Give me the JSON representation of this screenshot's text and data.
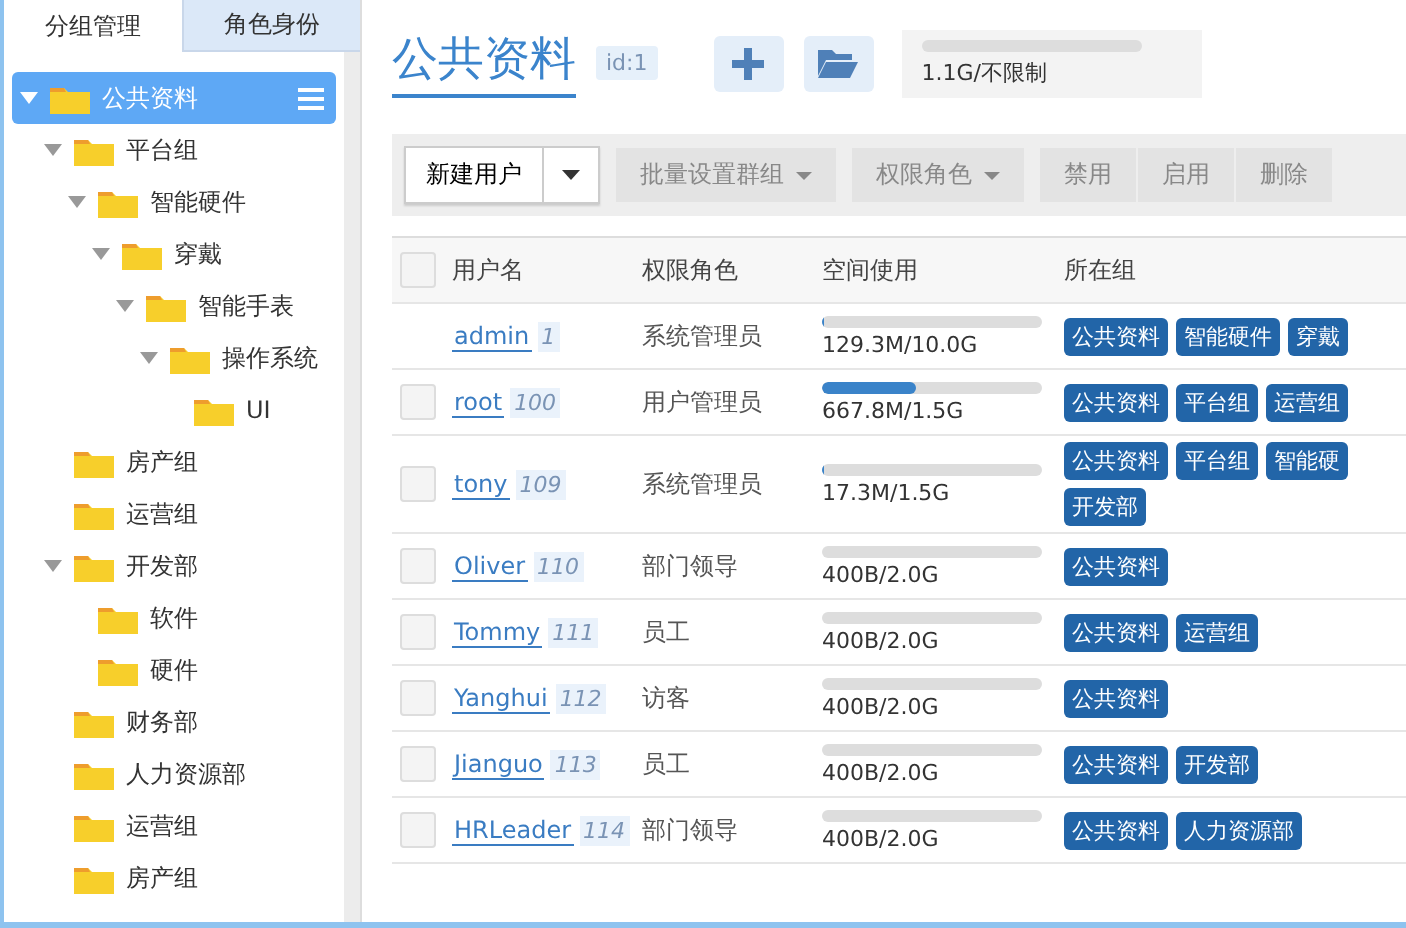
{
  "sidebar": {
    "tabs": [
      {
        "label": "分组管理",
        "selected": true
      },
      {
        "label": "角色身份",
        "selected": false
      }
    ],
    "tree": [
      {
        "label": "公共资料",
        "selected": true,
        "expanded": true,
        "children": [
          {
            "label": "平台组",
            "selected": false,
            "expanded": true,
            "children": [
              {
                "label": "智能硬件",
                "selected": false,
                "expanded": true,
                "children": [
                  {
                    "label": "穿戴",
                    "selected": false,
                    "expanded": true,
                    "children": [
                      {
                        "label": "智能手表",
                        "selected": false,
                        "expanded": true,
                        "children": [
                          {
                            "label": "操作系统",
                            "selected": false,
                            "expanded": true,
                            "children": [
                              {
                                "label": "UI",
                                "selected": false,
                                "expanded": false
                              }
                            ]
                          }
                        ]
                      }
                    ]
                  }
                ]
              }
            ]
          },
          {
            "label": "房产组",
            "selected": false,
            "expanded": false
          },
          {
            "label": "运营组",
            "selected": false,
            "expanded": false
          },
          {
            "label": "开发部",
            "selected": false,
            "expanded": true,
            "children": [
              {
                "label": "软件",
                "selected": false,
                "expanded": false
              },
              {
                "label": "硬件",
                "selected": false,
                "expanded": false
              }
            ]
          },
          {
            "label": "财务部",
            "selected": false,
            "expanded": false
          },
          {
            "label": "人力资源部",
            "selected": false,
            "expanded": false
          },
          {
            "label": "运营组",
            "selected": false,
            "expanded": false
          },
          {
            "label": "房产组",
            "selected": false,
            "expanded": false
          }
        ]
      }
    ]
  },
  "header": {
    "title": "公共资料",
    "id_badge": "id:1",
    "quota": {
      "reading": "1.1G/不限制"
    }
  },
  "toolbar": {
    "new_user": "新建用户",
    "buttons": [
      {
        "label": "批量设置群组",
        "kind": "dropdown"
      },
      {
        "label": "权限角色",
        "kind": "dropdown"
      }
    ],
    "actions": [
      "禁用",
      "启用",
      "删除"
    ]
  },
  "table": {
    "select_all": {
      "checked": false
    },
    "columns": [
      "用户名",
      "权限角色",
      "空间使用",
      "所在组"
    ],
    "rows": [
      {
        "name": "admin",
        "id": "1",
        "role": "系统管理员",
        "level": 0.013,
        "usage": "129.3M/10.0G",
        "groups": [
          "公共资料",
          "智能硬件",
          "穿戴"
        ],
        "kind": "fixed"
      },
      {
        "name": "root",
        "id": "100",
        "role": "用户管理员",
        "level": 0.43,
        "usage": "667.8M/1.5G",
        "groups": [
          "公共资料",
          "平台组",
          "运营组"
        ],
        "kind": "selectable",
        "checked": false
      },
      {
        "name": "tony",
        "id": "109",
        "role": "系统管理员",
        "level": 0.011,
        "usage": "17.3M/1.5G",
        "groups": [
          "公共资料",
          "平台组",
          "智能硬",
          "开发部"
        ],
        "kind": "selectable",
        "checked": false
      },
      {
        "name": "Oliver",
        "id": "110",
        "role": "部门领导",
        "usage": "400B/2.0G",
        "groups": [
          "公共资料"
        ],
        "kind": "selectable",
        "checked": false
      },
      {
        "name": "Tommy",
        "id": "111",
        "role": "员工",
        "usage": "400B/2.0G",
        "groups": [
          "公共资料",
          "运营组"
        ],
        "kind": "selectable",
        "checked": false
      },
      {
        "name": "Yanghui",
        "id": "112",
        "role": "访客",
        "usage": "400B/2.0G",
        "groups": [
          "公共资料"
        ],
        "kind": "selectable",
        "checked": false
      },
      {
        "name": "Jianguo",
        "id": "113",
        "role": "员工",
        "usage": "400B/2.0G",
        "groups": [
          "公共资料",
          "开发部"
        ],
        "kind": "selectable",
        "checked": false
      },
      {
        "name": "HRLeader",
        "id": "114",
        "role": "部门领导",
        "usage": "400B/2.0G",
        "groups": [
          "公共资料",
          "人力资源部"
        ],
        "kind": "selectable",
        "checked": false
      }
    ]
  }
}
